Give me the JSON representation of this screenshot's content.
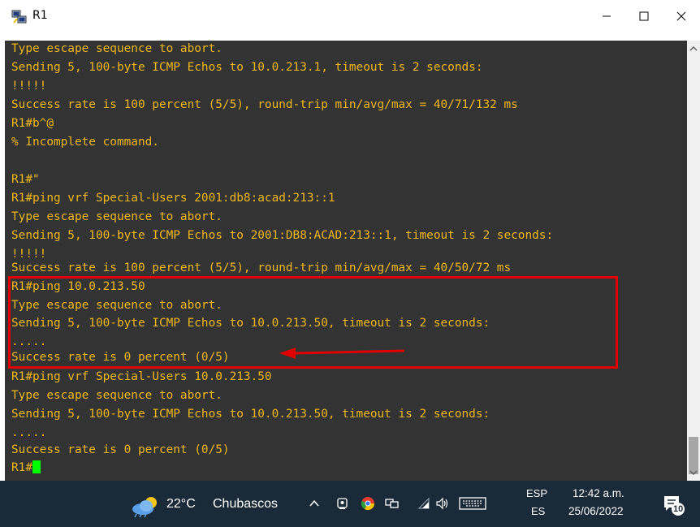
{
  "window": {
    "title": "R1",
    "icon": "putty-icon",
    "minimize_glyph": "—",
    "maximize_glyph": "☐",
    "close_glyph": "✕"
  },
  "terminal": {
    "lines": [
      "Type escape sequence to abort.",
      "Sending 5, 100-byte ICMP Echos to 10.0.213.1, timeout is 2 seconds:",
      "!!!!!",
      "Success rate is 100 percent (5/5), round-trip min/avg/max = 40/71/132 ms",
      "R1#b^@",
      "% Incomplete command.",
      "",
      "R1#\"",
      "R1#ping vrf Special-Users 2001:db8:acad:213::1",
      "Type escape sequence to abort.",
      "Sending 5, 100-byte ICMP Echos to 2001:DB8:ACAD:213::1, timeout is 2 seconds:",
      "!!!!!",
      "Success rate is 100 percent (5/5), round-trip min/avg/max = 40/50/72 ms",
      "R1#ping 10.0.213.50",
      "Type escape sequence to abort.",
      "Sending 5, 100-byte ICMP Echos to 10.0.213.50, timeout is 2 seconds:",
      ".....",
      "Success rate is 0 percent (0/5)",
      "R1#ping vrf Special-Users 10.0.213.50",
      "Type escape sequence to abort.",
      "Sending 5, 100-byte ICMP Echos to 10.0.213.50, timeout is 2 seconds:",
      ".....",
      "Success rate is 0 percent (0/5)",
      "R1#"
    ],
    "text_color": "#f2b81a",
    "background": "#333333",
    "cursor_color": "#00ff00",
    "annotation_color": "#e00000"
  },
  "taskbar": {
    "weather_icon": "weather-cloud-sun-icon",
    "temperature": "22°C",
    "weather_text": "Chubascos",
    "tray_icons": [
      "chevron-up-icon",
      "meet-now-icon",
      "chrome-icon",
      "network-icon",
      "wifi-icon",
      "volume-icon",
      "keyboard-icon"
    ],
    "lang_top": "ESP",
    "lang_bottom": "ES",
    "time": "12:42 a.m.",
    "date": "25/06/2022",
    "notification_count": "10",
    "background": "#1b2a38"
  }
}
